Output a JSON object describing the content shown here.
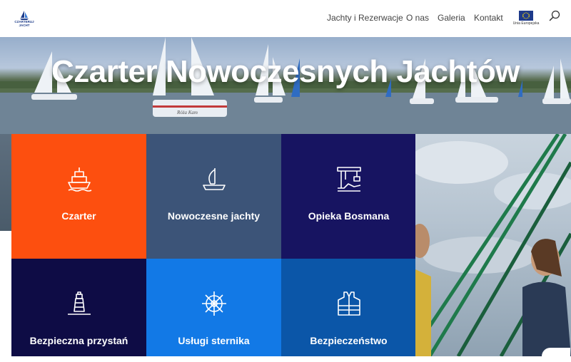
{
  "header": {
    "logo_text": "CZARTERUJ JACHT",
    "nav": [
      "Jachty i Rezerwacje",
      "O nas",
      "Galeria",
      "Kontakt"
    ],
    "eu_label": "Unia Europejska",
    "search_icon": "search-icon"
  },
  "hero": {
    "title": "Czarter Nowoczesnych Jachtów",
    "boat_name": "Róża Kam"
  },
  "tiles": [
    {
      "label": "Czarter",
      "icon": "ship-icon",
      "color": "#fd4f0f"
    },
    {
      "label": "Nowoczesne jachty",
      "icon": "sailboat-icon",
      "color": "#3c5478"
    },
    {
      "label": "Opieka Bosmana",
      "icon": "crane-icon",
      "color": "#171461"
    },
    {
      "label": "Bezpieczna przystań",
      "icon": "lighthouse-icon",
      "color": "#0e0c45"
    },
    {
      "label": "Usługi sternika",
      "icon": "helm-icon",
      "color": "#1279e6"
    },
    {
      "label": "Bezpieczeństwo",
      "icon": "life-vest-icon",
      "color": "#0b56a8"
    }
  ]
}
